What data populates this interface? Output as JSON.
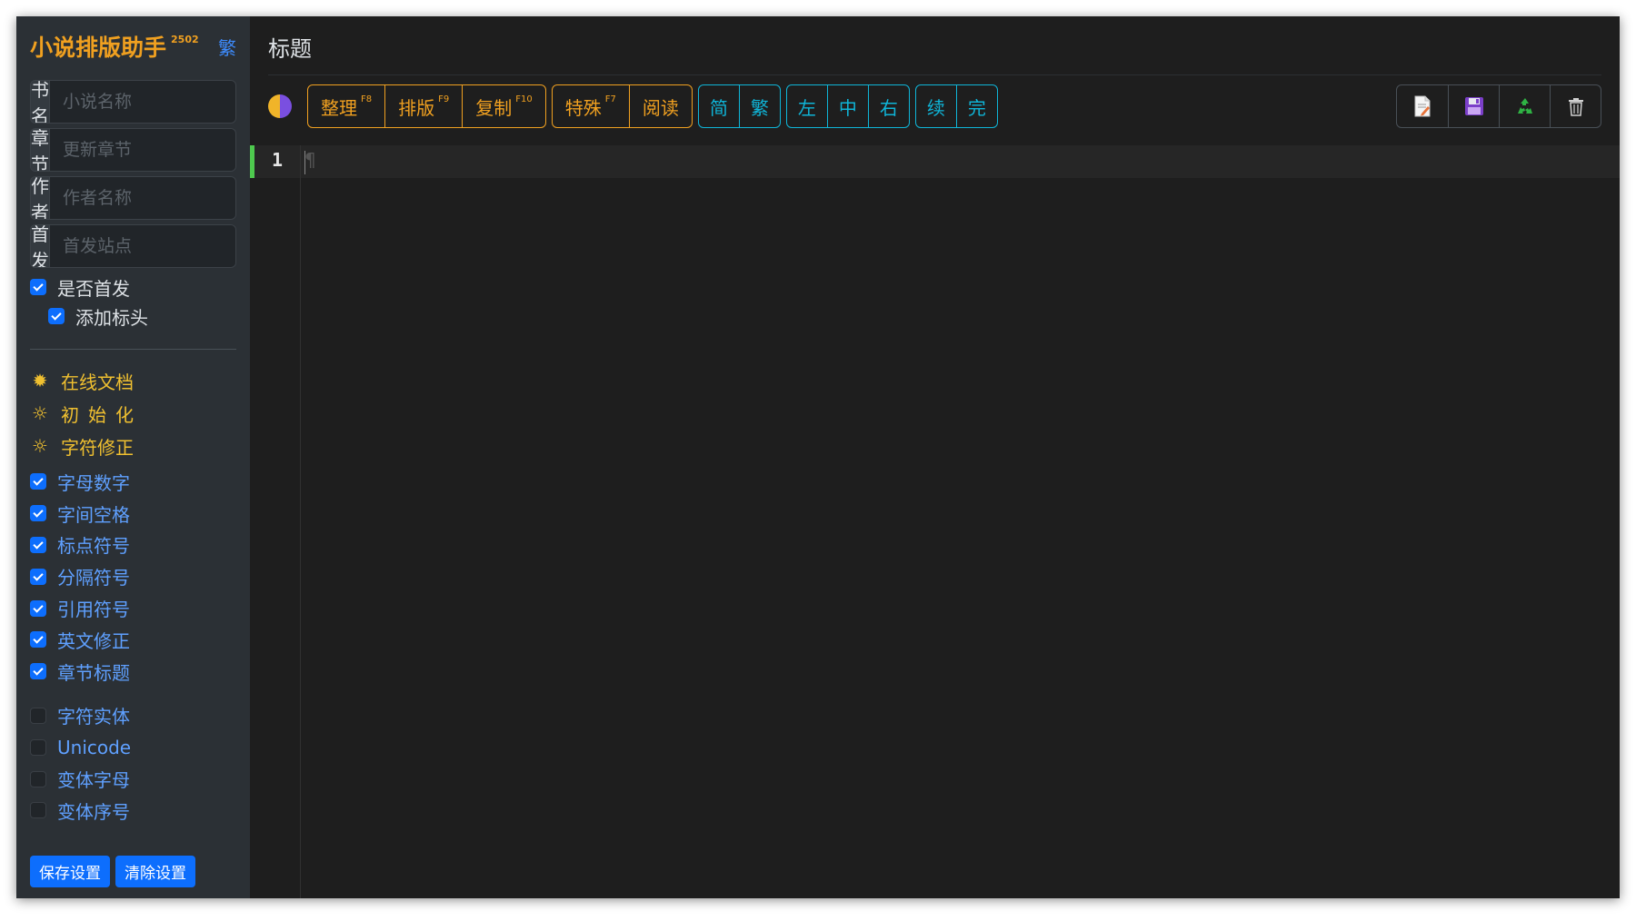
{
  "app": {
    "title": "小说排版助手",
    "version": "2502",
    "trad_toggle": "繁"
  },
  "fields": [
    {
      "label": "书名",
      "placeholder": "小说名称"
    },
    {
      "label": "章节",
      "placeholder": "更新章节"
    },
    {
      "label": "作者",
      "placeholder": "作者名称"
    },
    {
      "label": "首发",
      "placeholder": "首发站点"
    }
  ],
  "checks": {
    "first_release": {
      "label": "是否首发",
      "checked": true
    },
    "add_header": {
      "label": "添加标头",
      "checked": true
    }
  },
  "menu": [
    {
      "label": "在线文档",
      "icon": "sun-filled-icon"
    },
    {
      "label": "初始化",
      "icon": "sun-outline-icon"
    },
    {
      "label": "字符修正",
      "icon": "sun-outline-icon"
    }
  ],
  "options_on": [
    "字母数字",
    "字间空格",
    "标点符号",
    "分隔符号",
    "引用符号",
    "英文修正",
    "章节标题"
  ],
  "options_off": [
    "字符实体",
    "Unicode",
    "变体字母",
    "变体序号"
  ],
  "buttons": {
    "save": "保存设置",
    "clear": "清除设置"
  },
  "main": {
    "title": "标题"
  },
  "toolbar": {
    "group1": [
      {
        "label": "整理",
        "key": "F8"
      },
      {
        "label": "排版",
        "key": "F9"
      },
      {
        "label": "复制",
        "key": "F10"
      }
    ],
    "group2": [
      {
        "label": "特殊",
        "key": "F7"
      },
      {
        "label": "阅读",
        "key": ""
      }
    ],
    "group3": [
      "简",
      "繁"
    ],
    "group4": [
      "左",
      "中",
      "右"
    ],
    "group5": [
      "续",
      "完"
    ],
    "icons": [
      "new-file-icon",
      "save-disk-icon",
      "recycle-icon",
      "trash-icon"
    ]
  },
  "editor": {
    "line_number": "1",
    "pilcrow": "¶"
  },
  "colors": {
    "accent_orange": "#f0a020",
    "accent_cyan": "#0fb5d8",
    "primary_blue": "#0d6efd",
    "active_line_marker": "#4ec94e"
  }
}
